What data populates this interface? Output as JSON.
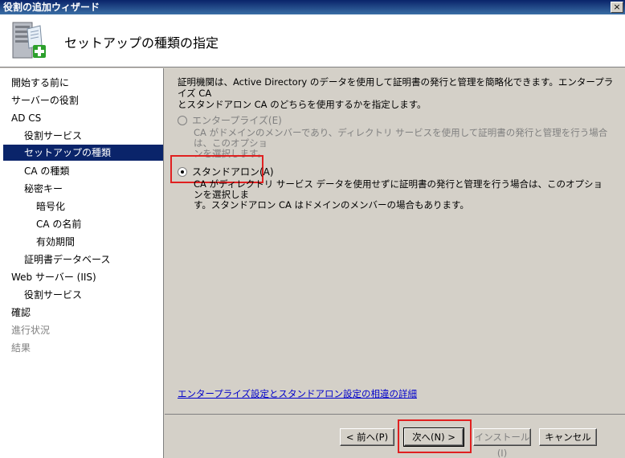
{
  "window": {
    "title": "役割の追加ウィザード",
    "close_label": "×"
  },
  "header": {
    "title": "セットアップの種類の指定",
    "icon": "server-add-icon"
  },
  "sidebar": {
    "items": [
      {
        "label": "開始する前に",
        "state": "normal"
      },
      {
        "label": "サーバーの役割",
        "state": "normal"
      },
      {
        "label": "AD CS",
        "state": "normal"
      },
      {
        "label": "役割サービス",
        "state": "normal"
      },
      {
        "label": "セットアップの種類",
        "state": "selected"
      },
      {
        "label": "CA の種類",
        "state": "normal"
      },
      {
        "label": "秘密キー",
        "state": "normal"
      },
      {
        "label": "暗号化",
        "state": "normal"
      },
      {
        "label": "CA の名前",
        "state": "normal"
      },
      {
        "label": "有効期間",
        "state": "normal"
      },
      {
        "label": "証明書データベース",
        "state": "normal"
      },
      {
        "label": "Web サーバー (IIS)",
        "state": "normal"
      },
      {
        "label": "役割サービス",
        "state": "normal"
      },
      {
        "label": "確認",
        "state": "normal"
      },
      {
        "label": "進行状況",
        "state": "disabled"
      },
      {
        "label": "結果",
        "state": "disabled"
      }
    ]
  },
  "main": {
    "description_line1": "証明機関は、Active Directory のデータを使用して証明書の発行と管理を簡略化できます。エンタープライズ CA",
    "description_line2": "とスタンドアロン CA のどちらを使用するかを指定します。",
    "option_enterprise": {
      "label": "エンタープライズ(E)",
      "desc_line1": "CA がドメインのメンバーであり、ディレクトリ サービスを使用して証明書の発行と管理を行う場合は、このオプショ",
      "desc_line2": "ンを選択します。"
    },
    "option_standalone": {
      "label": "スタンドアロン(A)",
      "desc_line1": "CA がディレクトリ サービス データを使用せずに証明書の発行と管理を行う場合は、このオプションを選択しま",
      "desc_line2": "す。スタンドアロン CA はドメインのメンバーの場合もあります。"
    },
    "link_text": "エンタープライズ設定とスタンドアロン設定の相違の詳細"
  },
  "footer": {
    "back_label": "< 前へ(P)",
    "next_label": "次へ(N) >",
    "install_label": "インストール(I)",
    "cancel_label": "キャンセル"
  },
  "colors": {
    "highlight": "#e02020",
    "selected_bg": "#0a246a",
    "link": "#0000cc"
  }
}
